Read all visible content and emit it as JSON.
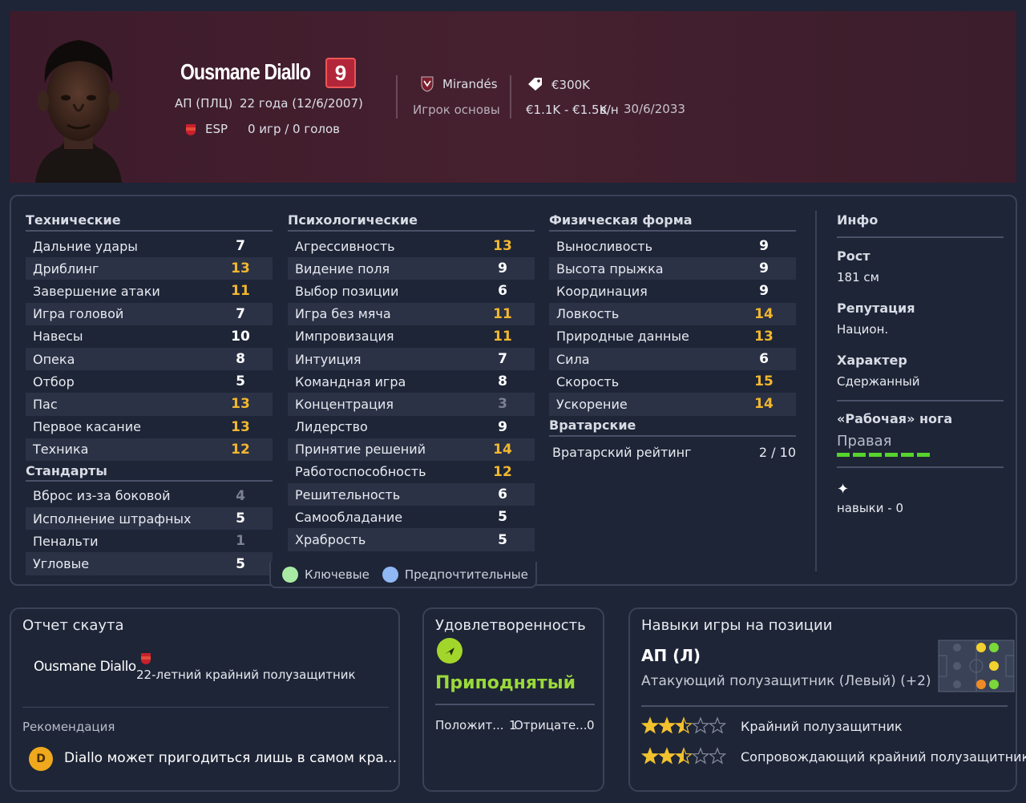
{
  "player": {
    "name": "Ousmane Diallo",
    "number": "9",
    "position": "АП (ПЛЦ)",
    "age": "22 года (12/6/2007)",
    "nationality": "ESP",
    "caps": "0 игр / 0 голов",
    "club": "Mirandés",
    "squad_status": "Игрок основы",
    "value": "€300K",
    "wage": "€1.1K - €1.5K",
    "wage_period": "в/н",
    "contract_end": "30/6/2033"
  },
  "technical": {
    "title": "Технические",
    "attrs": [
      {
        "label": "Дальние удары",
        "value": "7",
        "tone": "w"
      },
      {
        "label": "Дриблинг",
        "value": "13",
        "tone": "y"
      },
      {
        "label": "Завершение атаки",
        "value": "11",
        "tone": "y"
      },
      {
        "label": "Игра головой",
        "value": "7",
        "tone": "w"
      },
      {
        "label": "Навесы",
        "value": "10",
        "tone": "w"
      },
      {
        "label": "Опека",
        "value": "8",
        "tone": "w"
      },
      {
        "label": "Отбор",
        "value": "5",
        "tone": "w"
      },
      {
        "label": "Пас",
        "value": "13",
        "tone": "y"
      },
      {
        "label": "Первое касание",
        "value": "13",
        "tone": "y"
      },
      {
        "label": "Техника",
        "value": "12",
        "tone": "y"
      }
    ]
  },
  "set_pieces": {
    "title": "Стандарты",
    "attrs": [
      {
        "label": "Вброс из-за боковой",
        "value": "4",
        "tone": "g"
      },
      {
        "label": "Исполнение штрафных",
        "value": "5",
        "tone": "w"
      },
      {
        "label": "Пенальти",
        "value": "1",
        "tone": "g"
      },
      {
        "label": "Угловые",
        "value": "5",
        "tone": "w"
      }
    ]
  },
  "mental": {
    "title": "Психологические",
    "attrs": [
      {
        "label": "Агрессивность",
        "value": "13",
        "tone": "y"
      },
      {
        "label": "Видение поля",
        "value": "9",
        "tone": "w"
      },
      {
        "label": "Выбор позиции",
        "value": "6",
        "tone": "w"
      },
      {
        "label": "Игра без мяча",
        "value": "11",
        "tone": "y"
      },
      {
        "label": "Импровизация",
        "value": "11",
        "tone": "y"
      },
      {
        "label": "Интуиция",
        "value": "7",
        "tone": "w"
      },
      {
        "label": "Командная игра",
        "value": "8",
        "tone": "w"
      },
      {
        "label": "Концентрация",
        "value": "3",
        "tone": "g"
      },
      {
        "label": "Лидерство",
        "value": "9",
        "tone": "w"
      },
      {
        "label": "Принятие решений",
        "value": "14",
        "tone": "y"
      },
      {
        "label": "Работоспособность",
        "value": "12",
        "tone": "y"
      },
      {
        "label": "Решительность",
        "value": "6",
        "tone": "w"
      },
      {
        "label": "Самообладание",
        "value": "5",
        "tone": "w"
      },
      {
        "label": "Храбрость",
        "value": "5",
        "tone": "w"
      }
    ]
  },
  "physical": {
    "title": "Физическая форма",
    "attrs": [
      {
        "label": "Выносливость",
        "value": "9",
        "tone": "w"
      },
      {
        "label": "Высота прыжка",
        "value": "9",
        "tone": "w"
      },
      {
        "label": "Координация",
        "value": "9",
        "tone": "w"
      },
      {
        "label": "Ловкость",
        "value": "14",
        "tone": "y"
      },
      {
        "label": "Природные данные",
        "value": "13",
        "tone": "y"
      },
      {
        "label": "Сила",
        "value": "6",
        "tone": "w"
      },
      {
        "label": "Скорость",
        "value": "15",
        "tone": "y"
      },
      {
        "label": "Ускорение",
        "value": "14",
        "tone": "y"
      }
    ]
  },
  "goalkeeping": {
    "title": "Вратарские",
    "rating_label": "Вратарский рейтинг",
    "rating_value": "2 / 10"
  },
  "info": {
    "title": "Инфо",
    "height_label": "Рост",
    "height_value": "181 см",
    "reputation_label": "Репутация",
    "reputation_value": "Национ.",
    "personality_label": "Характер",
    "personality_value": "Сдержанный",
    "foot_label": "«Рабочая» нога",
    "foot_value": "Правая",
    "skills_text": "навыки - 0"
  },
  "legend": {
    "key_label": "Ключевые",
    "preferred_label": "Предпочтительные",
    "key_color": "#a8eaa4",
    "preferred_color": "#8fb8f5"
  },
  "scout": {
    "title": "Отчет скаута",
    "player_name": "Ousmane Diallo",
    "summary": "22-летний крайний полузащитник",
    "recommendation_label": "Рекомендация",
    "grade": "D",
    "recommendation_text": "Diallo может пригодиться лишь в самом кра..."
  },
  "happiness": {
    "title": "Удовлетворенность",
    "mood": "Приподнятый",
    "positive_label": "Положит...",
    "positive_count": "1",
    "negative_label": "Отрицате...",
    "negative_count": "0"
  },
  "positions": {
    "title": "Навыки игры на позиции",
    "best_position": "АП (Л)",
    "best_role": "Атакующий полузащитник (Левый) (+2)",
    "roles": [
      {
        "label": "Крайний полузащитник",
        "stars": 2.5
      },
      {
        "label": "Сопровождающий крайний полузащитник",
        "stars": 2.5
      }
    ]
  },
  "colors": {
    "yellow": "#f2b72e",
    "green": "#9ad93a",
    "accent_red": "#b3263a"
  }
}
